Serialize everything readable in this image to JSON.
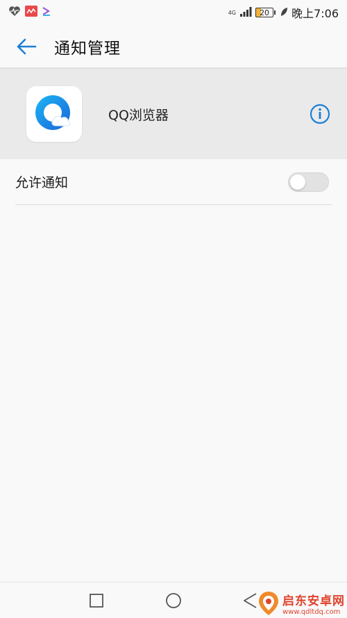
{
  "status_bar": {
    "network": "4G",
    "battery": "20",
    "time": "晚上7:06"
  },
  "header": {
    "title": "通知管理"
  },
  "app": {
    "name": "QQ浏览器"
  },
  "settings": {
    "allow_notifications_label": "允许通知",
    "allow_notifications_enabled": false
  },
  "watermark": {
    "title": "启东安卓网",
    "url": "www.qdltdq.com"
  },
  "colors": {
    "accent": "#1a7fd6",
    "header_bg": "#eaeaea",
    "page_bg": "#f9f9f9",
    "watermark": "#e0422c"
  }
}
